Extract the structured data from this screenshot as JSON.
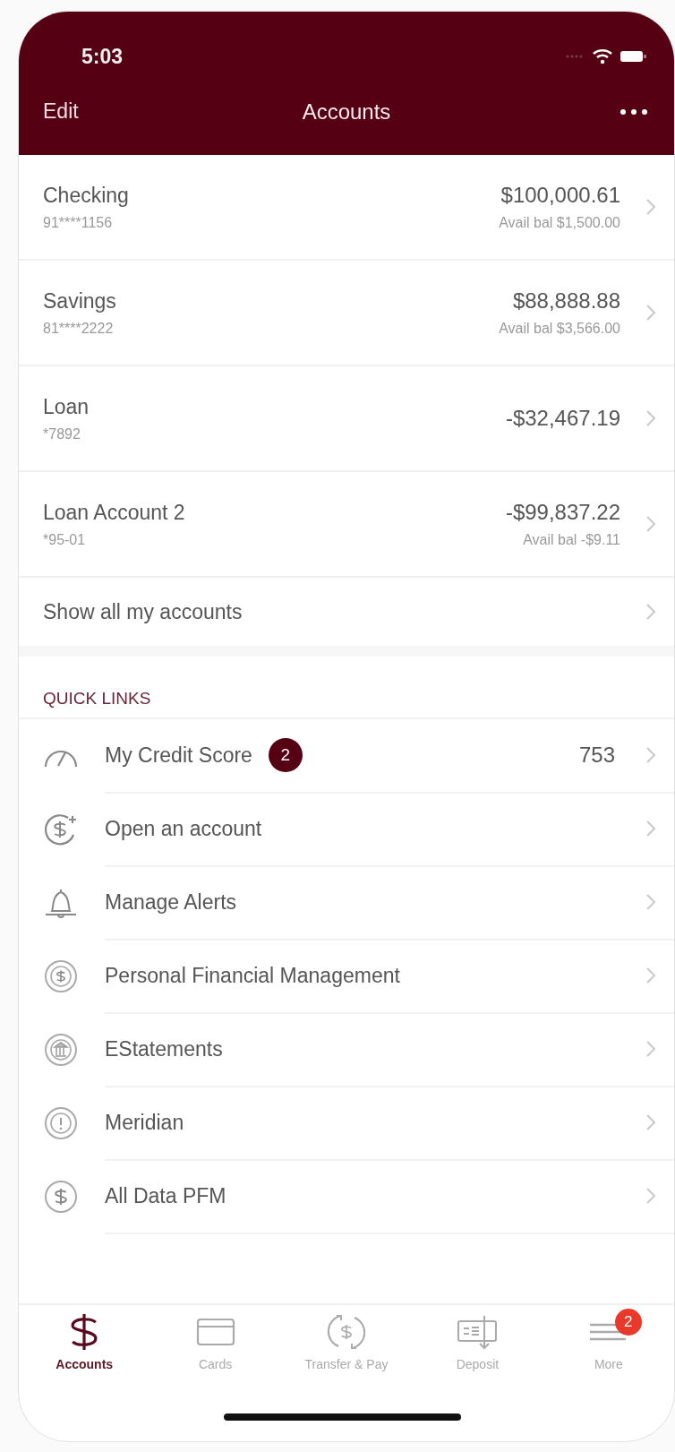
{
  "status_bar": {
    "time": "5:03"
  },
  "nav": {
    "left": "Edit",
    "title": "Accounts"
  },
  "accounts": [
    {
      "name": "Checking",
      "number": "91****1156",
      "balance": "$100,000.61",
      "available": "Avail bal $1,500.00"
    },
    {
      "name": "Savings",
      "number": "81****2222",
      "balance": "$88,888.88",
      "available": "Avail bal $3,566.00"
    },
    {
      "name": "Loan",
      "number": "*7892",
      "balance": "-$32,467.19"
    },
    {
      "name": "Loan Account 2",
      "number": "*95-01",
      "balance": "-$99,837.22",
      "available": "Avail bal -$9.11"
    }
  ],
  "show_all": "Show all my accounts",
  "quick_links": {
    "title": "QUICK LINKS",
    "items": [
      {
        "kind": "gauge",
        "label": "My Credit Score",
        "badge": "2",
        "value": "753"
      },
      {
        "kind": "dollar-plus",
        "label": "Open an account"
      },
      {
        "kind": "bell",
        "label": "Manage Alerts"
      },
      {
        "kind": "dollar-circle",
        "label": "Personal Financial Management"
      },
      {
        "kind": "bank",
        "label": "EStatements"
      },
      {
        "kind": "alert",
        "label": "Meridian"
      },
      {
        "kind": "dollar",
        "label": "All Data PFM"
      }
    ]
  },
  "tabs": [
    {
      "kind": "dollar",
      "label": "Accounts",
      "selected": true
    },
    {
      "kind": "card",
      "label": "Cards",
      "selected": false
    },
    {
      "kind": "transfer",
      "label": "Transfer & Pay",
      "selected": false
    },
    {
      "kind": "deposit",
      "label": "Deposit",
      "selected": false
    },
    {
      "kind": "menu",
      "label": "More",
      "selected": false,
      "badge": "2"
    }
  ]
}
